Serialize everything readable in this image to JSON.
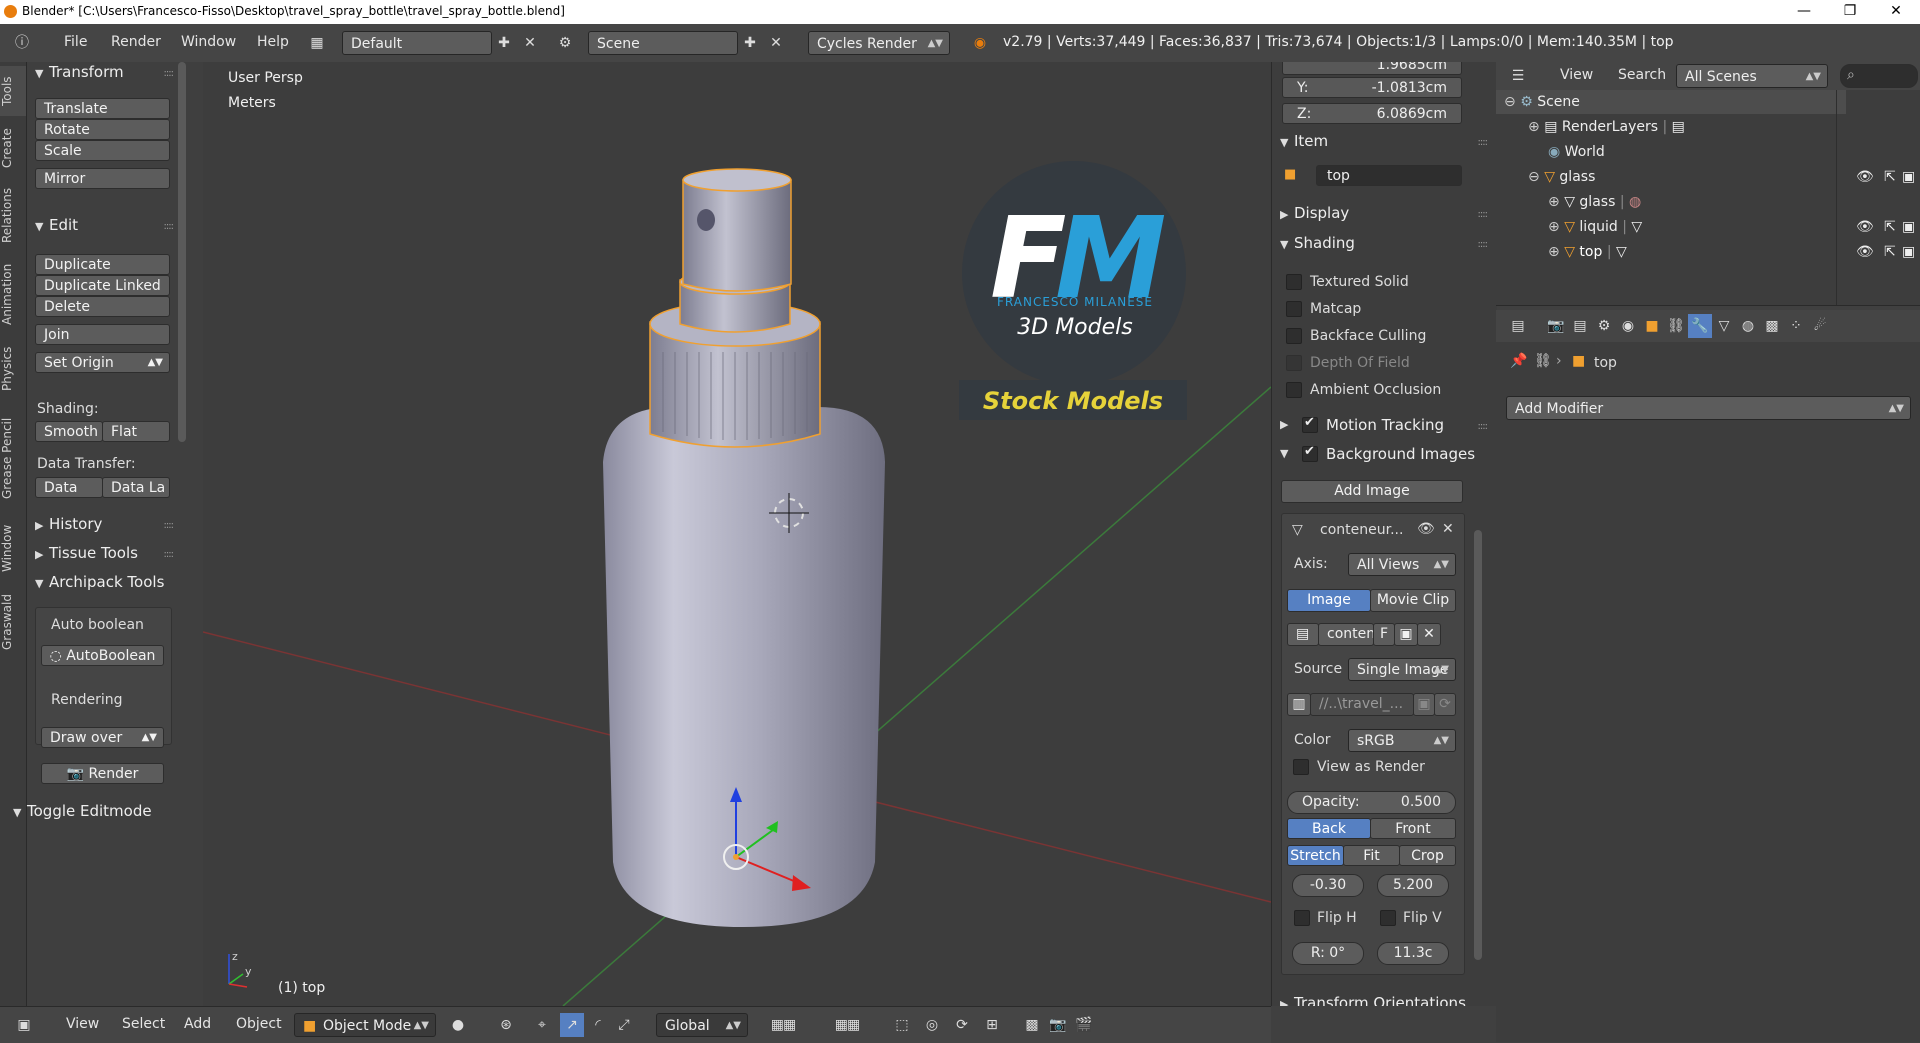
{
  "window": {
    "title": "Blender* [C:\\Users\\Francesco-Fisso\\Desktop\\travel_spray_bottle\\travel_spray_bottle.blend]",
    "minimize": "—",
    "maximize": "❐",
    "close": "✕"
  },
  "info_header": {
    "menus": [
      "File",
      "Render",
      "Window",
      "Help"
    ],
    "layout": "Default",
    "scene": "Scene",
    "engine": "Cycles Render",
    "stats": "v2.79 | Verts:37,449 | Faces:36,837 | Tris:73,674 | Objects:1/3 | Lamps:0/0 | Mem:140.35M | top"
  },
  "tabs": [
    "Tools",
    "Create",
    "Relations",
    "Animation",
    "Physics",
    "Grease Pencil",
    "Window",
    "Graswald"
  ],
  "toolshelf": {
    "transform": {
      "title": "Transform",
      "buttons": [
        "Translate",
        "Rotate",
        "Scale",
        "Mirror"
      ]
    },
    "edit": {
      "title": "Edit",
      "buttons": [
        "Duplicate",
        "Duplicate Linked",
        "Delete",
        "Join"
      ],
      "set_origin": "Set Origin",
      "shading_label": "Shading:",
      "smooth": "Smooth",
      "flat": "Flat",
      "data_transfer_label": "Data Transfer:",
      "data": "Data",
      "data_la": "Data La"
    },
    "history": "History",
    "tissue_tools": "Tissue Tools",
    "archipack": {
      "title": "Archipack Tools",
      "auto_boolean_label": "Auto boolean",
      "auto_boolean_btn": "AutoBoolean",
      "rendering_label": "Rendering",
      "draw_over": "Draw over",
      "render": "Render"
    },
    "toggle_editmode": "Toggle Editmode"
  },
  "viewport": {
    "view_name": "User Persp",
    "units": "Meters",
    "object_label": "(1) top",
    "watermark": {
      "initials_f": "F",
      "initials_m": "M",
      "name": "FRANCESCO MILANESE",
      "subtitle": "3D Models",
      "stock": "Stock Models"
    }
  },
  "viewport_header": {
    "menus": [
      "View",
      "Select",
      "Add",
      "Object"
    ],
    "mode": "Object Mode",
    "orientation": "Global"
  },
  "npanel": {
    "x_value": "1.9685cm",
    "y_label": "Y:",
    "y_value": "-1.0813cm",
    "z_label": "Z:",
    "z_value": "6.0869cm",
    "item_title": "Item",
    "item_name": "top",
    "display_title": "Display",
    "shading_title": "Shading",
    "shading_options": [
      {
        "label": "Textured Solid",
        "checked": false,
        "disabled": false
      },
      {
        "label": "Matcap",
        "checked": false,
        "disabled": false
      },
      {
        "label": "Backface Culling",
        "checked": false,
        "disabled": false
      },
      {
        "label": "Depth Of Field",
        "checked": false,
        "disabled": true
      },
      {
        "label": "Ambient Occlusion",
        "checked": false,
        "disabled": false
      }
    ],
    "motion_tracking": "Motion Tracking",
    "background_images": "Background Images",
    "add_image": "Add Image",
    "bg_item_name": "conteneur...",
    "axis_label": "Axis:",
    "axis_value": "All Views",
    "image_tab": "Image",
    "movie_clip_tab": "Movie Clip",
    "image_name": "conten",
    "image_f": "F",
    "source_label": "Source",
    "source_value": "Single Image",
    "path": "//..\\travel_...",
    "color_label": "Color",
    "color_value": "sRGB",
    "view_as_render": "View as Render",
    "opacity_label": "Opacity:",
    "opacity_value": "0.500",
    "back": "Back",
    "front": "Front",
    "stretch": "Stretch",
    "fit": "Fit",
    "crop": "Crop",
    "offset_x": "-0.30",
    "offset_y": "5.200",
    "flip_h": "Flip H",
    "flip_v": "Flip V",
    "rotation": "R: 0°",
    "size": "11.3c",
    "transform_orientations": "Transform Orientations"
  },
  "outliner": {
    "view": "View",
    "search": "Search",
    "filter": "All Scenes",
    "rows": [
      "Scene",
      "RenderLayers",
      "World",
      "glass",
      "glass",
      "liquid",
      "top"
    ]
  },
  "properties": {
    "object_name": "top",
    "add_modifier": "Add Modifier"
  },
  "colors": {
    "accent_blue": "#5680c2",
    "selection_orange": "#f0a030",
    "fm_blue": "#2a9fd8",
    "stock_yellow": "#e6d23a"
  }
}
